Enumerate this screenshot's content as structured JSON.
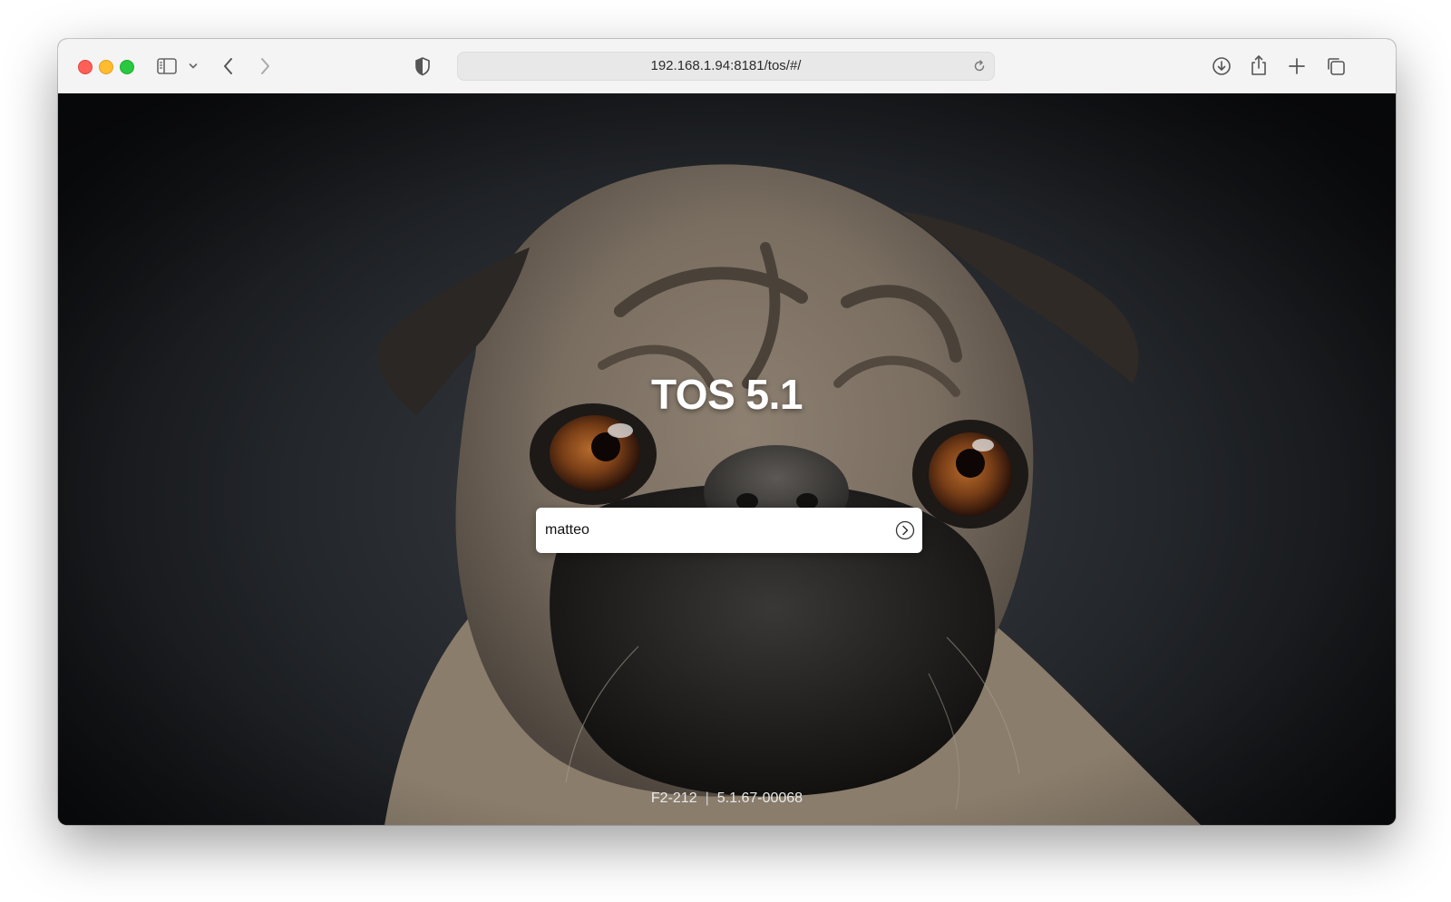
{
  "browser": {
    "url": "192.168.1.94:8181/tos/#/",
    "icons": [
      "sidebar-icon",
      "chevron-down-icon",
      "back-icon",
      "forward-icon",
      "shield-icon",
      "reload-icon",
      "download-icon",
      "share-icon",
      "new-tab-icon",
      "tab-overview-icon"
    ]
  },
  "login": {
    "title": "TOS 5.1",
    "username": "matteo",
    "submit_icon": "arrow-right-circle-icon"
  },
  "footer": {
    "model": "F2-212",
    "separator": "|",
    "version": "5.1.67-00068"
  },
  "colors": {
    "close": "#fe5f57",
    "minimize": "#febc2e",
    "maximize": "#28c840",
    "title_text": "#ffffff",
    "input_bg": "#ffffff"
  }
}
